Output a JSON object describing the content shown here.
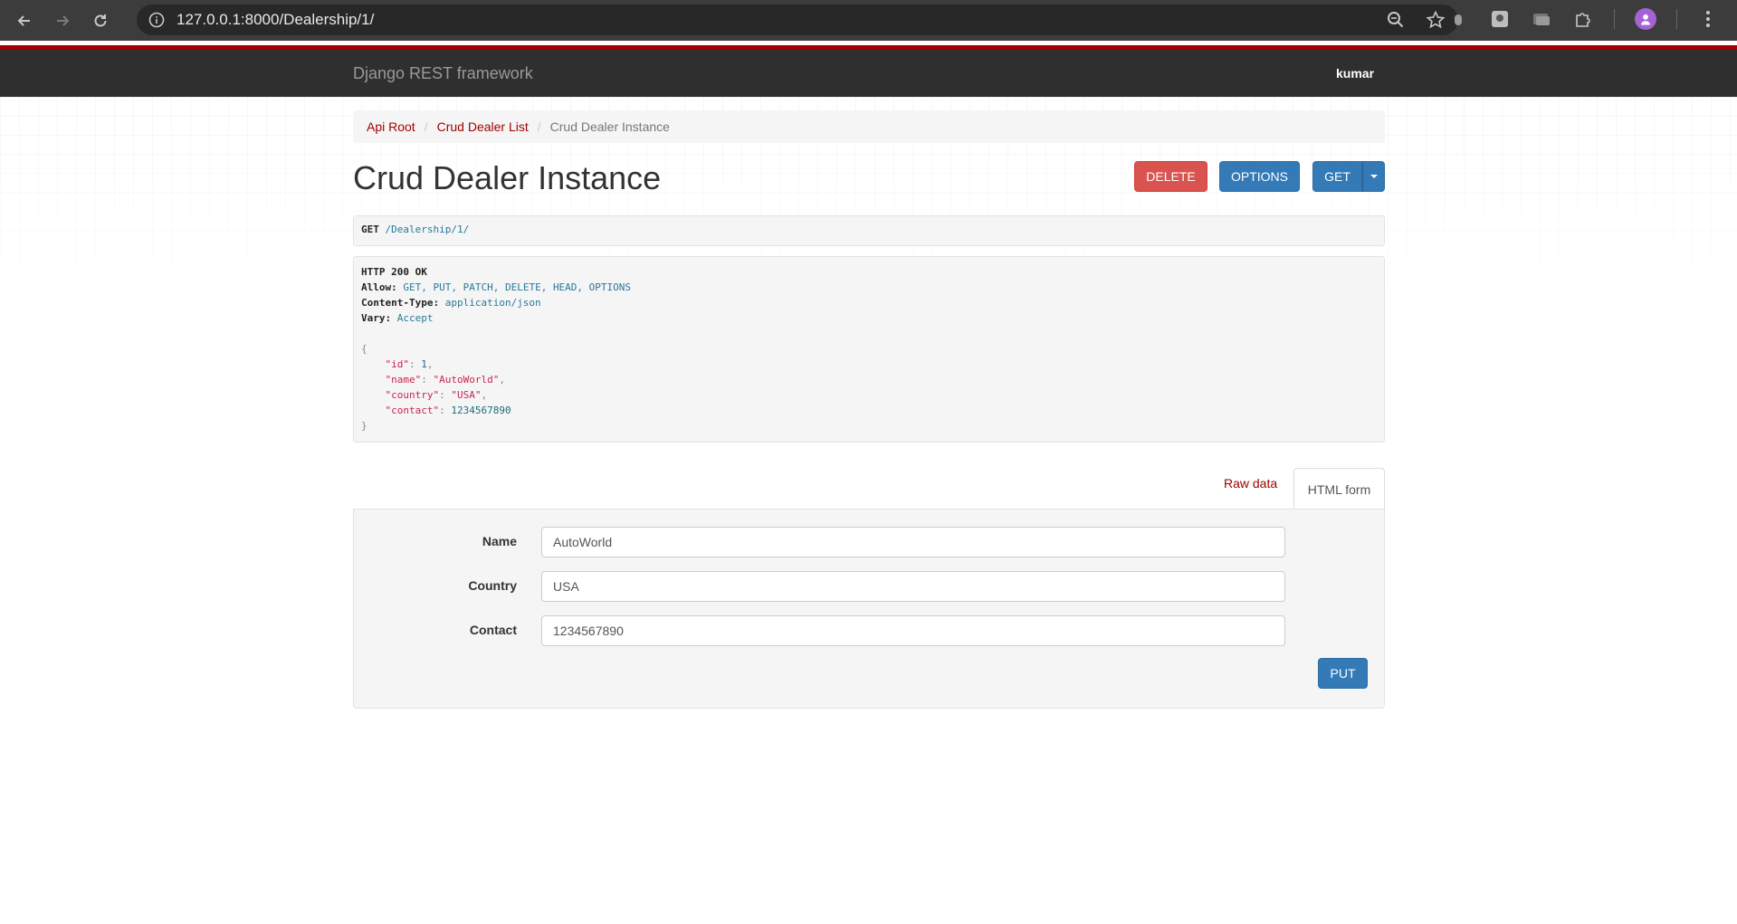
{
  "browser": {
    "url": "127.0.0.1:8000/Dealership/1/"
  },
  "navbar": {
    "brand": "Django REST framework",
    "user": "kumar"
  },
  "breadcrumb": {
    "items": [
      "Api Root",
      "Crud Dealer List"
    ],
    "active": "Crud Dealer Instance",
    "divider": "/"
  },
  "page": {
    "title": "Crud Dealer Instance"
  },
  "actions": {
    "delete_label": "DELETE",
    "options_label": "OPTIONS",
    "get_label": "GET"
  },
  "request": {
    "method": "GET",
    "path": "/Dealership/1/"
  },
  "response": {
    "status": "HTTP 200 OK",
    "headers": [
      {
        "name": "Allow:",
        "value": "GET, PUT, PATCH, DELETE, HEAD, OPTIONS"
      },
      {
        "name": "Content-Type:",
        "value": "application/json"
      },
      {
        "name": "Vary:",
        "value": "Accept"
      }
    ],
    "open_brace": "{",
    "close_brace": "}",
    "body": [
      {
        "key": "\"id\"",
        "value": "1",
        "type": "num",
        "comma": ","
      },
      {
        "key": "\"name\"",
        "value": "\"AutoWorld\"",
        "type": "str",
        "comma": ","
      },
      {
        "key": "\"country\"",
        "value": "\"USA\"",
        "type": "str",
        "comma": ","
      },
      {
        "key": "\"contact\"",
        "value": "1234567890",
        "type": "num",
        "comma": ""
      }
    ]
  },
  "tabs": {
    "raw": "Raw data",
    "html": "HTML form"
  },
  "form": {
    "fields": [
      {
        "label": "Name",
        "value": "AutoWorld"
      },
      {
        "label": "Country",
        "value": "USA"
      },
      {
        "label": "Contact",
        "value": "1234567890"
      }
    ],
    "submit_label": "PUT"
  },
  "icons": {
    "back": "arrow-left-icon",
    "forward": "arrow-right-icon",
    "reload": "reload-icon",
    "info": "info-icon",
    "zoom": "zoom-icon",
    "bookmark": "star-icon",
    "extensions": "puzzle-icon",
    "menu": "kebab-menu-icon"
  },
  "colors": {
    "brand_red": "#a30000",
    "primary_blue": "#337ab7",
    "danger_red": "#d9534f"
  }
}
